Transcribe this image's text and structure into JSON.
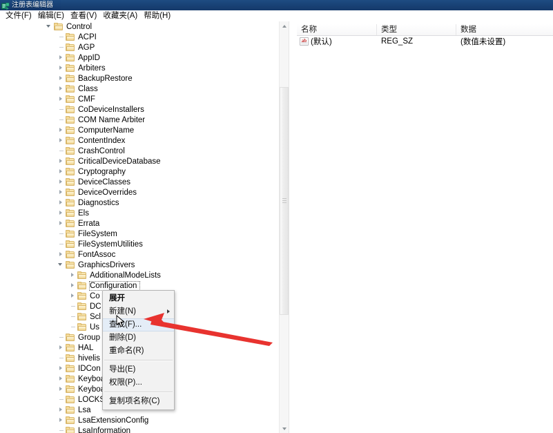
{
  "window": {
    "title": "注册表编辑器",
    "icon": "regedit-icon"
  },
  "menubar": {
    "items": [
      {
        "label": "文件(F)",
        "name": "menu-file"
      },
      {
        "label": "编辑(E)",
        "name": "menu-edit"
      },
      {
        "label": "查看(V)",
        "name": "menu-view"
      },
      {
        "label": "收藏夹(A)",
        "name": "menu-favorites"
      },
      {
        "label": "帮助(H)",
        "name": "menu-help"
      }
    ]
  },
  "tree": {
    "rows": [
      {
        "label": "Control",
        "indent": 0,
        "state": "expanded",
        "selected": false
      },
      {
        "label": "ACPI",
        "indent": 1,
        "state": "leaf",
        "selected": false
      },
      {
        "label": "AGP",
        "indent": 1,
        "state": "leaf",
        "selected": false
      },
      {
        "label": "AppID",
        "indent": 1,
        "state": "collapsed",
        "selected": false
      },
      {
        "label": "Arbiters",
        "indent": 1,
        "state": "collapsed",
        "selected": false
      },
      {
        "label": "BackupRestore",
        "indent": 1,
        "state": "collapsed",
        "selected": false
      },
      {
        "label": "Class",
        "indent": 1,
        "state": "collapsed",
        "selected": false
      },
      {
        "label": "CMF",
        "indent": 1,
        "state": "collapsed",
        "selected": false
      },
      {
        "label": "CoDeviceInstallers",
        "indent": 1,
        "state": "leaf",
        "selected": false
      },
      {
        "label": "COM Name Arbiter",
        "indent": 1,
        "state": "leaf",
        "selected": false
      },
      {
        "label": "ComputerName",
        "indent": 1,
        "state": "collapsed",
        "selected": false
      },
      {
        "label": "ContentIndex",
        "indent": 1,
        "state": "collapsed",
        "selected": false
      },
      {
        "label": "CrashControl",
        "indent": 1,
        "state": "leaf",
        "selected": false
      },
      {
        "label": "CriticalDeviceDatabase",
        "indent": 1,
        "state": "collapsed",
        "selected": false
      },
      {
        "label": "Cryptography",
        "indent": 1,
        "state": "collapsed",
        "selected": false
      },
      {
        "label": "DeviceClasses",
        "indent": 1,
        "state": "collapsed",
        "selected": false
      },
      {
        "label": "DeviceOverrides",
        "indent": 1,
        "state": "collapsed",
        "selected": false
      },
      {
        "label": "Diagnostics",
        "indent": 1,
        "state": "collapsed",
        "selected": false
      },
      {
        "label": "Els",
        "indent": 1,
        "state": "collapsed",
        "selected": false
      },
      {
        "label": "Errata",
        "indent": 1,
        "state": "collapsed",
        "selected": false
      },
      {
        "label": "FileSystem",
        "indent": 1,
        "state": "leaf",
        "selected": false
      },
      {
        "label": "FileSystemUtilities",
        "indent": 1,
        "state": "leaf",
        "selected": false
      },
      {
        "label": "FontAssoc",
        "indent": 1,
        "state": "collapsed",
        "selected": false
      },
      {
        "label": "GraphicsDrivers",
        "indent": 1,
        "state": "expanded",
        "selected": false
      },
      {
        "label": "AdditionalModeLists",
        "indent": 2,
        "state": "collapsed",
        "selected": false
      },
      {
        "label": "Configuration",
        "indent": 2,
        "state": "collapsed",
        "selected": true
      },
      {
        "label": "Co",
        "indent": 2,
        "state": "collapsed",
        "selected": false
      },
      {
        "label": "DC",
        "indent": 2,
        "state": "leaf",
        "selected": false
      },
      {
        "label": "Scl",
        "indent": 2,
        "state": "leaf",
        "selected": false
      },
      {
        "label": "Us",
        "indent": 2,
        "state": "leaf",
        "selected": false
      },
      {
        "label": "Group",
        "indent": 1,
        "state": "leaf",
        "selected": false
      },
      {
        "label": "HAL",
        "indent": 1,
        "state": "collapsed",
        "selected": false
      },
      {
        "label": "hivelis",
        "indent": 1,
        "state": "leaf",
        "selected": false
      },
      {
        "label": "IDCon",
        "indent": 1,
        "state": "collapsed",
        "selected": false
      },
      {
        "label": "Keyboard Layout",
        "indent": 1,
        "state": "collapsed",
        "selected": false
      },
      {
        "label": "Keyboard Layouts",
        "indent": 1,
        "state": "collapsed",
        "selected": false
      },
      {
        "label": "LOCKSDK",
        "indent": 1,
        "state": "leaf",
        "selected": false
      },
      {
        "label": "Lsa",
        "indent": 1,
        "state": "collapsed",
        "selected": false
      },
      {
        "label": "LsaExtensionConfig",
        "indent": 1,
        "state": "collapsed",
        "selected": false
      },
      {
        "label": "LsaInformation",
        "indent": 1,
        "state": "leaf",
        "selected": false
      }
    ]
  },
  "list": {
    "columns": [
      {
        "label": "名称",
        "name": "column-header-name"
      },
      {
        "label": "类型",
        "name": "column-header-type"
      },
      {
        "label": "数据",
        "name": "column-header-data"
      }
    ],
    "rows": [
      {
        "name": "(默认)",
        "type": "REG_SZ",
        "data": "(数值未设置)",
        "icon": "string-value-icon"
      }
    ]
  },
  "context_menu": {
    "items": [
      {
        "label": "展开",
        "name": "ctx-expand",
        "bold": true,
        "hovered": false,
        "submenu": false,
        "separator_after": false
      },
      {
        "label": "新建(N)",
        "name": "ctx-new",
        "bold": false,
        "hovered": false,
        "submenu": true,
        "separator_after": false
      },
      {
        "label": "查找(F)...",
        "name": "ctx-find",
        "bold": false,
        "hovered": true,
        "submenu": false,
        "separator_after": false
      },
      {
        "label": "删除(D)",
        "name": "ctx-delete",
        "bold": false,
        "hovered": false,
        "submenu": false,
        "separator_after": false
      },
      {
        "label": "重命名(R)",
        "name": "ctx-rename",
        "bold": false,
        "hovered": false,
        "submenu": false,
        "separator_after": true
      },
      {
        "label": "导出(E)",
        "name": "ctx-export",
        "bold": false,
        "hovered": false,
        "submenu": false,
        "separator_after": false
      },
      {
        "label": "权限(P)...",
        "name": "ctx-permissions",
        "bold": false,
        "hovered": false,
        "submenu": false,
        "separator_after": true
      },
      {
        "label": "复制项名称(C)",
        "name": "ctx-copy-key-name",
        "bold": false,
        "hovered": false,
        "submenu": false,
        "separator_after": false
      }
    ]
  },
  "annotation": {
    "color": "#e8332f",
    "type": "arrow",
    "points_to": "ctx-find"
  }
}
